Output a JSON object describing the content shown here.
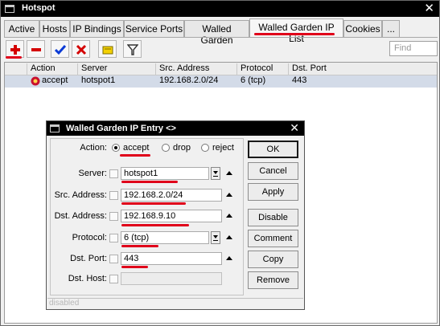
{
  "window": {
    "title": "Hotspot",
    "close_glyph": "✕"
  },
  "tabs": [
    {
      "label": "Active"
    },
    {
      "label": "Hosts"
    },
    {
      "label": "IP Bindings"
    },
    {
      "label": "Service Ports"
    },
    {
      "label": "Walled Garden"
    },
    {
      "label": "Walled Garden IP List"
    },
    {
      "label": "Cookies"
    },
    {
      "label": "..."
    }
  ],
  "active_tab": "Walled Garden IP List",
  "toolbar": {
    "buttons": [
      {
        "icon": "add-icon",
        "color": "#d40000"
      },
      {
        "icon": "remove-icon",
        "color": "#d40000"
      },
      {
        "icon": "enable-check-icon",
        "color": "#0b3bd6"
      },
      {
        "icon": "disable-x-icon",
        "color": "#d40000"
      },
      {
        "icon": "comment-note-icon",
        "color": "#f4d100"
      },
      {
        "icon": "filter-icon",
        "color": "#333333"
      }
    ],
    "find_placeholder": "Find"
  },
  "list": {
    "columns": [
      "Action",
      "Server",
      "Src. Address",
      "Protocol",
      "Dst. Port"
    ],
    "rows": [
      {
        "action": "accept",
        "server": "hotspot1",
        "src": "192.168.2.0/24",
        "protocol": "6 (tcp)",
        "dst_port": "443"
      }
    ]
  },
  "dialog": {
    "title": "Walled Garden IP Entry <>",
    "close_glyph": "✕",
    "action_label": "Action:",
    "action_options": [
      "accept",
      "drop",
      "reject"
    ],
    "action_selected": "accept",
    "fields": {
      "server": {
        "label": "Server:",
        "value": "hotspot1"
      },
      "src_address": {
        "label": "Src. Address:",
        "value": "192.168.2.0/24"
      },
      "dst_address": {
        "label": "Dst. Address:",
        "value": "192.168.9.10"
      },
      "protocol": {
        "label": "Protocol:",
        "value": "6 (tcp)"
      },
      "dst_port": {
        "label": "Dst. Port:",
        "value": "443"
      },
      "dst_host": {
        "label": "Dst. Host:",
        "value": ""
      }
    },
    "buttons": [
      "OK",
      "Cancel",
      "Apply",
      "Disable",
      "Comment",
      "Copy",
      "Remove"
    ],
    "status": "disabled"
  },
  "colors": {
    "highlight_underline": "#e0001a",
    "selected_row": "#d3dbe8"
  }
}
